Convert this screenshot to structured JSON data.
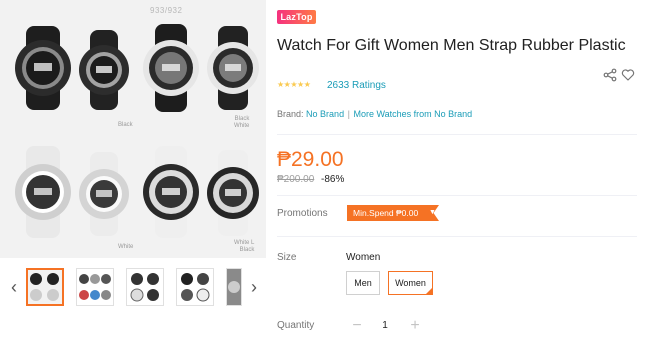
{
  "gallery": {
    "watermark": "933/932",
    "captions": {
      "top_middle": "Black",
      "top_right": "Black\nWhite",
      "bottom_middle": "White",
      "bottom_right": "White L\nBlack"
    },
    "nav": {
      "prev_icon": "chevron-left-icon",
      "next_icon": "chevron-right-icon"
    }
  },
  "product": {
    "badge": "LazTop",
    "title": "Watch For Gift Women Men Strap Rubber Plastic",
    "rating": {
      "stars": 5,
      "count_text": "2633 Ratings"
    },
    "brand": {
      "label": "Brand:",
      "name": "No Brand",
      "separator": "|",
      "more_link": "More Watches from No Brand"
    },
    "price": {
      "current": "₱29.00",
      "original": "₱200.00",
      "discount": "-86%"
    },
    "promotions": {
      "label": "Promotions",
      "tag": "Min.Spend ₱0.00"
    },
    "size": {
      "label": "Size",
      "selected": "Women",
      "options": [
        "Men",
        "Women"
      ]
    },
    "quantity": {
      "label": "Quantity",
      "value": "1"
    }
  },
  "colors": {
    "accent": "#f57224",
    "link": "#1a9cb7",
    "star": "#faca51"
  }
}
